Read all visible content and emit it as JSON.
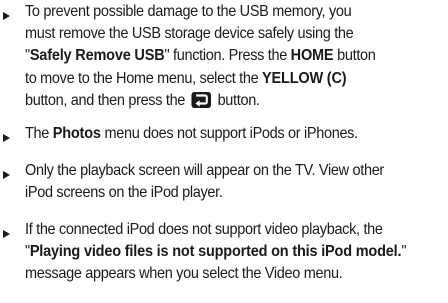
{
  "notes": [
    {
      "lines": [
        [
          "To prevent possible damage to the USB memory, you"
        ],
        [
          "must remove the USB storage device safely using the"
        ],
        [
          "\"",
          "Safely Remove USB",
          "\" function. Press the ",
          "HOME",
          " button"
        ],
        [
          "to move to the Home menu, select the ",
          "YELLOW (C)"
        ],
        [
          "button, and then press the ",
          "",
          " button."
        ]
      ],
      "icon": "return-button-icon"
    },
    {
      "lines": [
        [
          "The ",
          "Photos",
          " menu does not support iPods or iPhones."
        ]
      ]
    },
    {
      "lines": [
        [
          "Only the playback screen will appear on the TV. View other"
        ],
        [
          "iPod screens on the iPod player."
        ]
      ]
    },
    {
      "lines": [
        [
          "If the connected iPod does not support video playback, the"
        ],
        [
          "\"",
          "Playing video files is not supported on this iPod model.",
          "\""
        ],
        [
          "message appears when you select the Video menu."
        ]
      ]
    }
  ],
  "colors": {
    "text": "#1a1a1a",
    "background": "#ffffff"
  }
}
